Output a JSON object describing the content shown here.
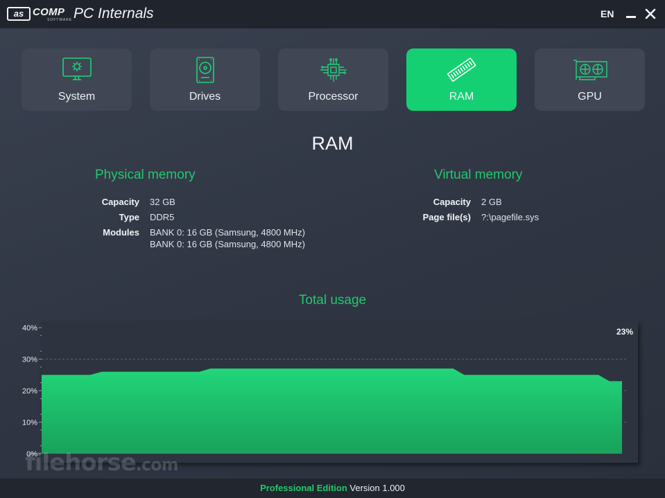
{
  "app": {
    "logo_box": "as",
    "logo_word": "COMP",
    "logo_sub": "SOFTWARE",
    "title": "PC Internals",
    "language": "EN"
  },
  "tabs": [
    {
      "label": "System",
      "icon": "monitor-gear-icon"
    },
    {
      "label": "Drives",
      "icon": "hard-drive-icon"
    },
    {
      "label": "Processor",
      "icon": "cpu-chip-icon"
    },
    {
      "label": "RAM",
      "icon": "ram-module-icon",
      "active": true
    },
    {
      "label": "GPU",
      "icon": "graphics-card-icon"
    }
  ],
  "page": {
    "heading": "RAM"
  },
  "physical_memory": {
    "title": "Physical memory",
    "capacity_label": "Capacity",
    "capacity_value": "32 GB",
    "type_label": "Type",
    "type_value": "DDR5",
    "modules_label": "Modules",
    "modules": [
      "BANK 0: 16 GB (Samsung, 4800 MHz)",
      "BANK 0: 16 GB (Samsung, 4800 MHz)"
    ]
  },
  "virtual_memory": {
    "title": "Virtual memory",
    "capacity_label": "Capacity",
    "capacity_value": "2 GB",
    "pagefile_label": "Page file(s)",
    "pagefile_value": "?:\\pagefile.sys"
  },
  "usage": {
    "title": "Total usage",
    "current": "23%"
  },
  "chart_data": {
    "type": "area",
    "title": "Total usage",
    "yticks": [
      "40%",
      "30%",
      "20%",
      "10%",
      "0%"
    ],
    "ylim": [
      0,
      40
    ],
    "grid": true,
    "x": [
      0,
      1,
      2,
      3,
      4,
      5,
      6,
      7,
      8,
      9,
      10,
      11,
      12,
      13,
      14,
      15,
      16
    ],
    "values": [
      25,
      25,
      26,
      26,
      26,
      27,
      27,
      27,
      27,
      27,
      27,
      27,
      25,
      25,
      25,
      25,
      23
    ],
    "current_label": "23%",
    "fill_color": "#15b560",
    "line_color": "#22d67a"
  },
  "watermark": {
    "text": "filehorse",
    "suffix": ".com"
  },
  "footer": {
    "edition": "Professional Edition",
    "version": "Version 1.000"
  },
  "colors": {
    "accent": "#14d072",
    "background": "#343a46",
    "tab": "#404654",
    "titlebar": "#20242c"
  }
}
